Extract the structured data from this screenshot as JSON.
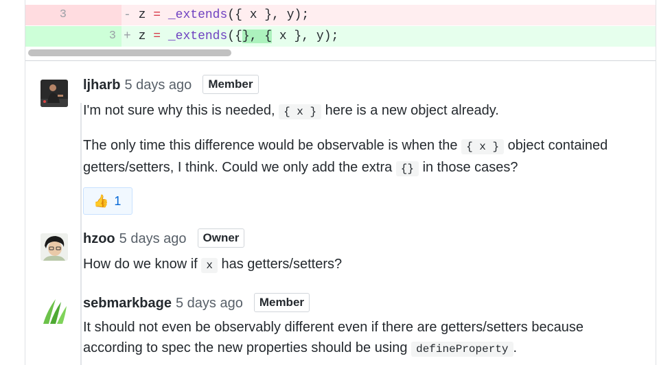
{
  "diff": {
    "del": {
      "old_no": "3",
      "new_no": "",
      "sign": "-",
      "code": [
        "z",
        "=",
        "_extends",
        "({ x }, y);"
      ]
    },
    "add": {
      "old_no": "",
      "new_no": "3",
      "sign": "+",
      "code": [
        "z",
        "=",
        "_extends",
        "({",
        "}, {",
        " x }, y);"
      ]
    }
  },
  "comments": [
    {
      "author": "ljharb",
      "time": "5 days ago",
      "role": "Member",
      "paragraph1": [
        "I'm not sure why this is needed,",
        "{ x }",
        "here is a new object already."
      ],
      "paragraph2": [
        "The only time this difference would be observable is when the",
        "{ x }",
        "object contained getters/setters, I think. Could we only add the extra",
        "{}",
        "in those cases?"
      ],
      "reaction": {
        "emoji": "👍",
        "count": "1"
      }
    },
    {
      "author": "hzoo",
      "time": "5 days ago",
      "role": "Owner",
      "paragraph1": [
        "How do we know if",
        "x",
        "has getters/setters?"
      ]
    },
    {
      "author": "sebmarkbage",
      "time": "5 days ago",
      "role": "Member",
      "paragraph1": [
        "It should not even be observably different even if there are getters/setters because according to spec the new properties should be using",
        "defineProperty",
        "."
      ]
    }
  ],
  "colors": {
    "del_bg": "#ffeef0",
    "add_bg": "#e6ffed",
    "add_highlight": "#acf2bd",
    "link": "#0366d6"
  }
}
